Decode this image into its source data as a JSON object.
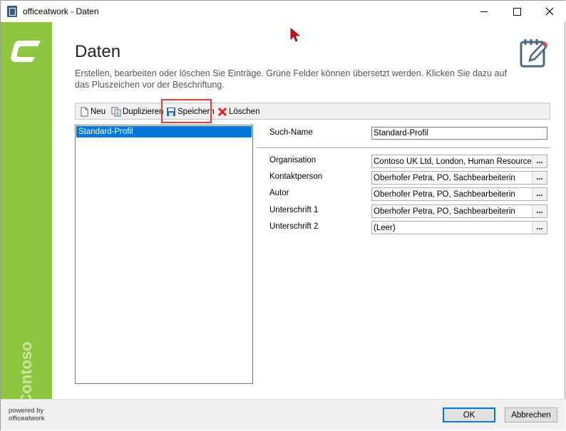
{
  "window": {
    "title": "officeatwork - Daten"
  },
  "sidebar": {
    "brand": "Contoso"
  },
  "header": {
    "title": "Daten",
    "description": "Erstellen, bearbeiten oder löschen Sie Einträge. Grüne Felder können übersetzt werden. Klicken Sie dazu auf das Pluszeichen vor der Beschriftung."
  },
  "toolbar": {
    "new_label": "Neu",
    "duplicate_label": "Duplizieren",
    "save_label": "Speichern",
    "delete_label": "Löschen"
  },
  "profiles": {
    "items": [
      "Standard-Profil"
    ]
  },
  "form": {
    "search_name": {
      "label": "Such-Name",
      "value": "Standard-Profil"
    },
    "fields": [
      {
        "label": "Organisation",
        "value": "Contoso UK Ltd, London, Human Resources"
      },
      {
        "label": "Kontaktperson",
        "value": "Oberhofer Petra, PO, Sachbearbeiterin"
      },
      {
        "label": "Autor",
        "value": "Oberhofer Petra, PO, Sachbearbeiterin"
      },
      {
        "label": "Unterschrift 1",
        "value": "Oberhofer Petra, PO, Sachbearbeiterin"
      },
      {
        "label": "Unterschrift 2",
        "value": "(Leer)"
      }
    ],
    "picker_label": "..."
  },
  "footer": {
    "powered_by": "powered by",
    "powered_name": "officeatwork",
    "ok_label": "OK",
    "cancel_label": "Abbrechen"
  },
  "colors": {
    "sidebar": "#8dc63f",
    "selection": "#0078d7",
    "highlight": "#e0403a"
  }
}
